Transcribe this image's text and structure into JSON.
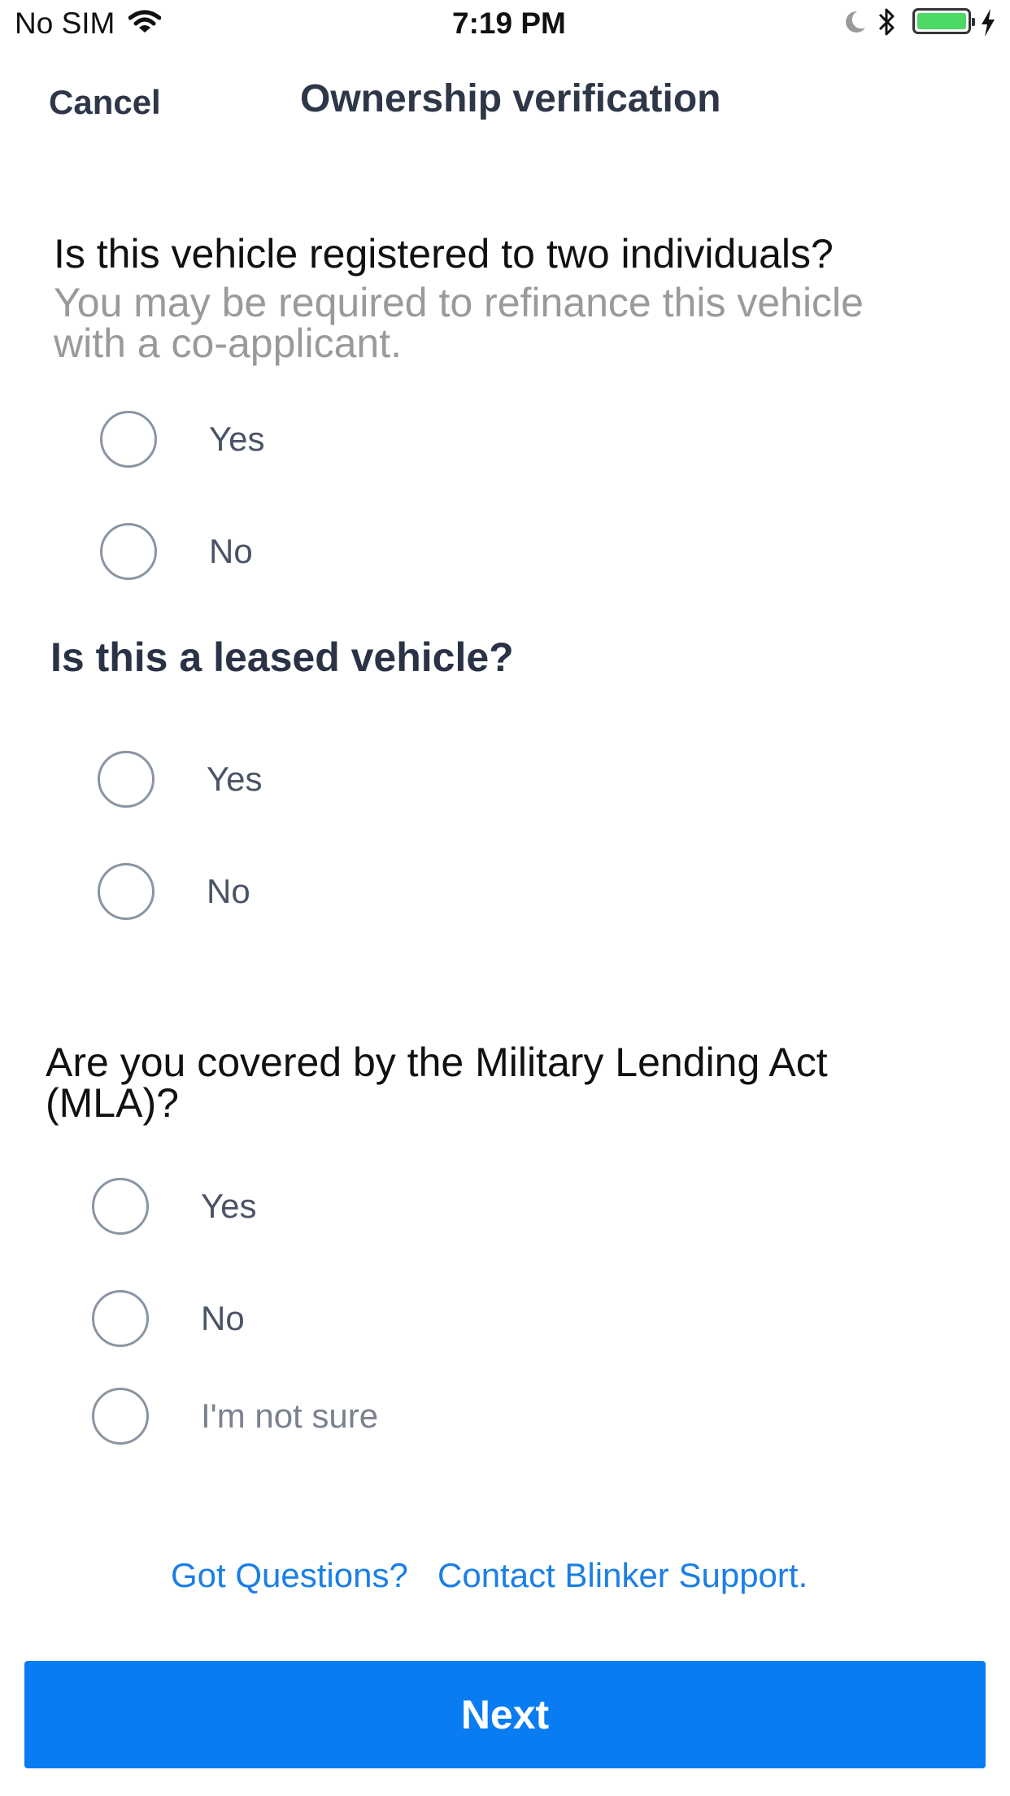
{
  "status_bar": {
    "carrier": "No SIM",
    "time": "7:19 PM"
  },
  "nav": {
    "cancel_label": "Cancel",
    "title": "Ownership verification"
  },
  "questions": [
    {
      "title": "Is this vehicle registered to two individuals?",
      "subtitle_lines": [
        "You may be required to refinance this vehicle",
        "with a co-applicant."
      ],
      "options": [
        "Yes",
        "No"
      ]
    },
    {
      "title": "Is this a leased vehicle?",
      "options": [
        "Yes",
        "No"
      ]
    },
    {
      "title_lines": [
        "Are you covered by the Military Lending Act",
        "(MLA)?"
      ],
      "options": [
        "Yes",
        "No",
        "I'm not sure"
      ]
    }
  ],
  "support": {
    "question": "Got Questions?",
    "link": "Contact Blinker Support."
  },
  "footer": {
    "next_label": "Next"
  },
  "colors": {
    "accent": "#0a7cf2",
    "link": "#1a7fe6",
    "battery": "#4cd964",
    "radio_border": "#8a95a3"
  },
  "icons": [
    "wifi-icon",
    "moon-icon",
    "bluetooth-icon",
    "battery-icon",
    "charging-bolt-icon"
  ]
}
